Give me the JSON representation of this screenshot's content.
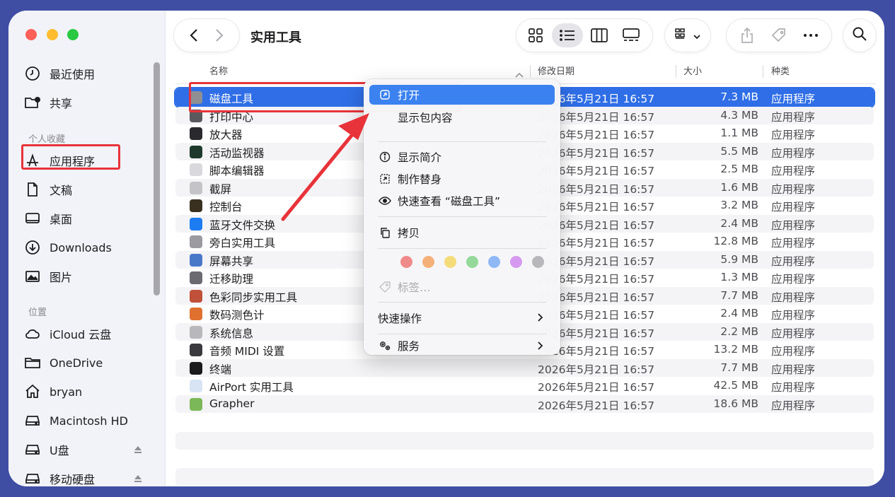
{
  "window": {
    "title": "实用工具"
  },
  "sidebar": {
    "favorites": [
      {
        "label": "最近使用",
        "icon": "clock-icon"
      },
      {
        "label": "共享",
        "icon": "shared-folder-icon"
      }
    ],
    "section_personal": "个人收藏",
    "personal": [
      {
        "label": "应用程序",
        "icon": "applications-icon"
      },
      {
        "label": "文稿",
        "icon": "document-icon"
      },
      {
        "label": "桌面",
        "icon": "desktop-icon"
      },
      {
        "label": "Downloads",
        "icon": "download-icon"
      },
      {
        "label": "图片",
        "icon": "pictures-icon"
      }
    ],
    "section_locations": "位置",
    "locations": [
      {
        "label": "iCloud 云盘",
        "icon": "cloud-icon"
      },
      {
        "label": "OneDrive",
        "icon": "folder-icon"
      },
      {
        "label": "bryan",
        "icon": "home-icon"
      },
      {
        "label": "Macintosh HD",
        "icon": "disk-icon"
      },
      {
        "label": "U盘",
        "icon": "disk-icon"
      },
      {
        "label": "移动硬盘",
        "icon": "disk-icon"
      }
    ]
  },
  "columns": {
    "name": "名称",
    "date": "修改日期",
    "size": "大小",
    "kind": "种类"
  },
  "files": [
    {
      "name": "磁盘工具",
      "date": "2026年5月21日 16:57",
      "size": "7.3 MB",
      "kind": "应用程序",
      "color": "#8e8e93"
    },
    {
      "name": "打印中心",
      "date": "2026年5月21日 16:57",
      "size": "4.3 MB",
      "kind": "应用程序",
      "color": "#5a5a5e"
    },
    {
      "name": "放大器",
      "date": "2026年5月21日 16:57",
      "size": "1.1 MB",
      "kind": "应用程序",
      "color": "#2a2a2e"
    },
    {
      "name": "活动监视器",
      "date": "2026年5月21日 16:57",
      "size": "5.5 MB",
      "kind": "应用程序",
      "color": "#1f3a2c"
    },
    {
      "name": "脚本编辑器",
      "date": "2026年5月21日 16:57",
      "size": "2.5 MB",
      "kind": "应用程序",
      "color": "#d9d9dd"
    },
    {
      "name": "截屏",
      "date": "2026年5月21日 16:57",
      "size": "1.6 MB",
      "kind": "应用程序",
      "color": "#c4c4c8"
    },
    {
      "name": "控制台",
      "date": "2026年5月21日 16:57",
      "size": "3.2 MB",
      "kind": "应用程序",
      "color": "#3a3020"
    },
    {
      "name": "蓝牙文件交换",
      "date": "2026年5月21日 16:57",
      "size": "2.4 MB",
      "kind": "应用程序",
      "color": "#1e7cf2"
    },
    {
      "name": "旁白实用工具",
      "date": "2026年5月21日 16:57",
      "size": "12.8 MB",
      "kind": "应用程序",
      "color": "#9a9aa0"
    },
    {
      "name": "屏幕共享",
      "date": "2026年5月21日 16:57",
      "size": "5.9 MB",
      "kind": "应用程序",
      "color": "#4a78c8"
    },
    {
      "name": "迁移助理",
      "date": "2026年5月21日 16:57",
      "size": "1.3 MB",
      "kind": "应用程序",
      "color": "#6a6a70"
    },
    {
      "name": "色彩同步实用工具",
      "date": "2026年5月21日 16:57",
      "size": "7.7 MB",
      "kind": "应用程序",
      "color": "#c0503a"
    },
    {
      "name": "数码测色计",
      "date": "2026年5月21日 16:57",
      "size": "2.4 MB",
      "kind": "应用程序",
      "color": "#e07030"
    },
    {
      "name": "系统信息",
      "date": "2026年5月21日 16:57",
      "size": "2.2 MB",
      "kind": "应用程序",
      "color": "#b8b8bc"
    },
    {
      "name": "音频 MIDI 设置",
      "date": "2026年5月21日 16:57",
      "size": "13.2 MB",
      "kind": "应用程序",
      "color": "#3a3a3e"
    },
    {
      "name": "终端",
      "date": "2026年5月21日 16:57",
      "size": "7.7 MB",
      "kind": "应用程序",
      "color": "#1a1a1c"
    },
    {
      "name": "AirPort 实用工具",
      "date": "2026年5月21日 16:57",
      "size": "42.5 MB",
      "kind": "应用程序",
      "color": "#d8e4f4"
    },
    {
      "name": "Grapher",
      "date": "2026年5月21日 16:57",
      "size": "18.6 MB",
      "kind": "应用程序",
      "color": "#7ab85a"
    }
  ],
  "context_menu": {
    "items": [
      {
        "label": "打开",
        "icon": "open-icon"
      },
      {
        "label": "显示包内容",
        "icon": ""
      },
      {
        "label": "显示简介",
        "icon": "info-icon"
      },
      {
        "label": "制作替身",
        "icon": "alias-icon"
      },
      {
        "label": "快速查看 “磁盘工具”",
        "icon": "eye-icon"
      },
      {
        "label": "拷贝",
        "icon": "copy-icon"
      },
      {
        "label": "标签…",
        "icon": "tag-icon"
      },
      {
        "label": "快速操作",
        "icon": ""
      },
      {
        "label": "服务",
        "icon": "gears-icon"
      }
    ],
    "tag_colors": [
      "#f08a8a",
      "#f5b07a",
      "#f5dc7a",
      "#94d99a",
      "#8fb8f5",
      "#d59af0",
      "#b8b8bc"
    ]
  },
  "colors": {
    "accent": "#2f6ee6",
    "annotation": "#e8333a"
  }
}
